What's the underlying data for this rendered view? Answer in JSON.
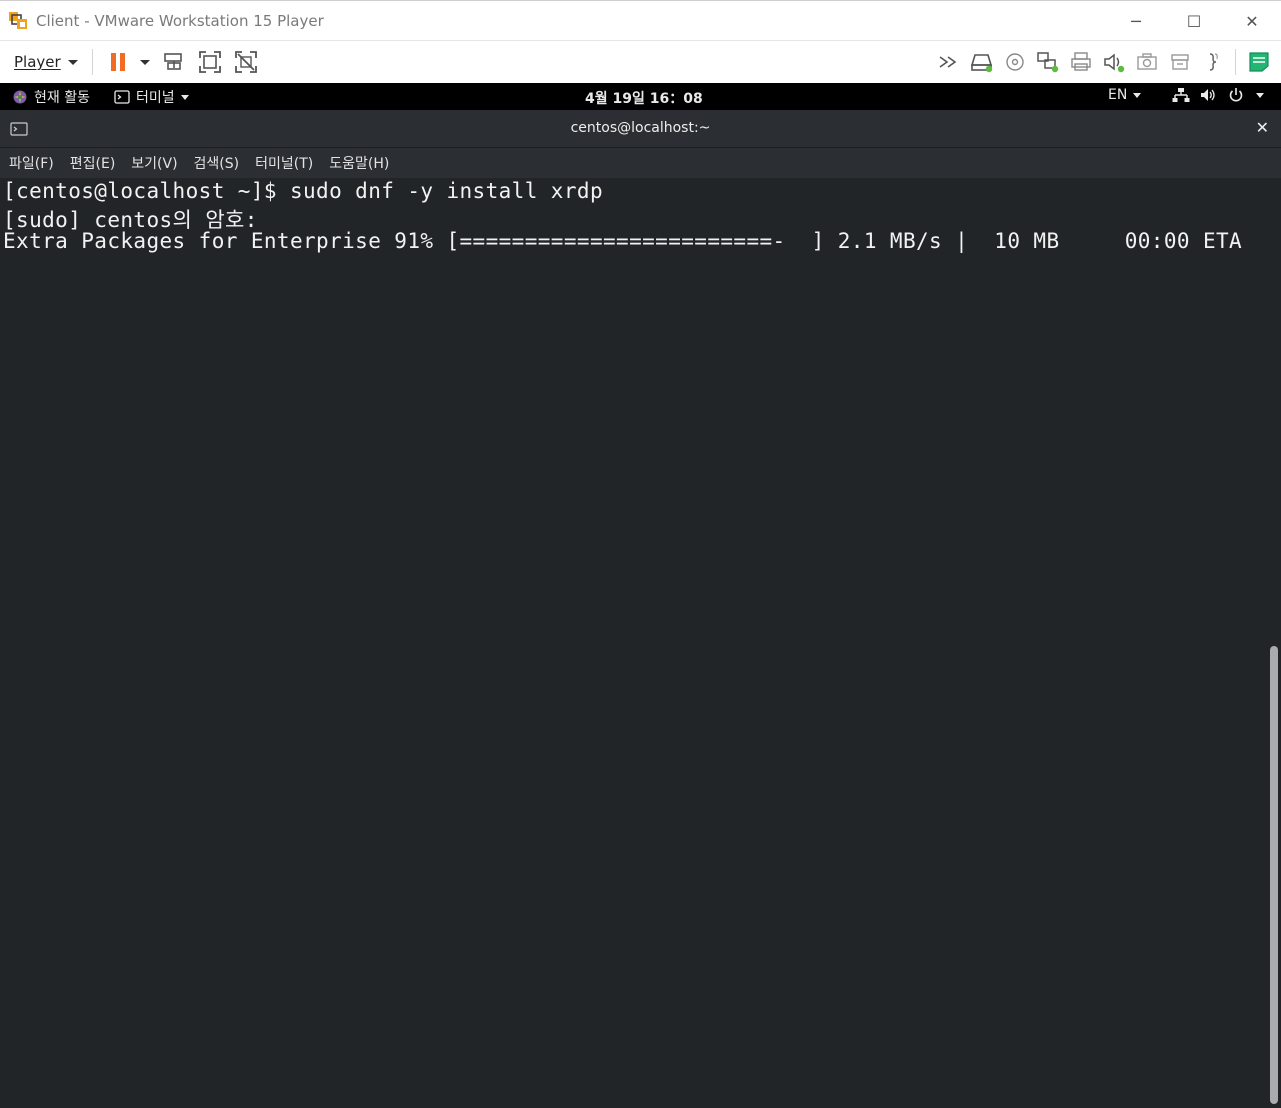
{
  "window": {
    "title": "Client - VMware Workstation 15 Player",
    "controls": {
      "minimize": "─",
      "maximize": "☐",
      "close": "✕"
    }
  },
  "toolbar": {
    "player_label": "Player",
    "pause_color": "#f26b25"
  },
  "gnome": {
    "activities": "현재 활동",
    "app_menu": "터미널",
    "clock": "4월 19일  16：08",
    "language": "EN"
  },
  "terminal": {
    "title": "centos@localhost:~",
    "close": "✕",
    "menu": [
      "파일(F)",
      "편집(E)",
      "보기(V)",
      "검색(S)",
      "터미널(T)",
      "도움말(H)"
    ],
    "lines": [
      "[centos@localhost ~]$ sudo dnf -y install xrdp",
      "[sudo] centos의 암호:",
      "Extra Packages for Enterprise 91% [========================-  ] 2.1 MB/s |  10 MB     00:00 ETA"
    ],
    "background": "#212528"
  }
}
